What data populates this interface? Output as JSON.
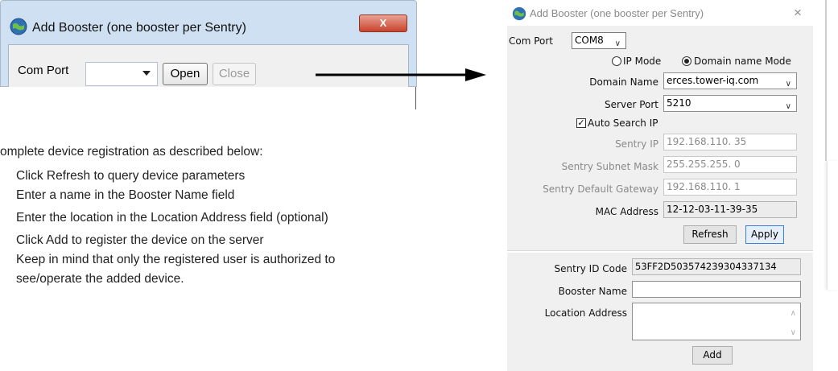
{
  "small_dialog": {
    "title": "Add Booster (one booster per Sentry)",
    "close_glyph": "X",
    "com_port_label": "Com Port",
    "com_port_value": "",
    "open_label": "Open",
    "close_label": "Close"
  },
  "instructions": {
    "intro": "omplete device registration as described below:",
    "steps": [
      "Click Refresh to query device parameters",
      "Enter a name in the Booster Name field",
      "Enter the location in the Location Address field (optional)",
      "Click Add to register the device on the server",
      "Keep in mind that only the registered user is authorized to",
      "see/operate the added device."
    ]
  },
  "dialog": {
    "title": "Add Booster (one booster per Sentry)",
    "close_glyph": "×",
    "com_port_label": "Com Port",
    "com_port_value": "COM8",
    "ip_mode_label": "IP Mode",
    "domain_mode_label": "Domain name Mode",
    "selected_mode": "domain",
    "domain_name_label": "Domain Name",
    "domain_name_value": "erces.tower-iq.com",
    "server_port_label": "Server Port",
    "server_port_value": "5210",
    "auto_search_label": "Auto Search IP",
    "auto_search_checked": true,
    "sentry_ip_label": "Sentry IP",
    "sentry_ip_value": "192.168.110. 35",
    "subnet_mask_label": "Sentry Subnet Mask",
    "subnet_mask_value": "255.255.255. 0",
    "gateway_label": "Sentry Default Gateway",
    "gateway_value": "192.168.110. 1",
    "mac_label": "MAC Address",
    "mac_value": "12-12-03-11-39-35",
    "refresh_label": "Refresh",
    "apply_label": "Apply",
    "sentry_id_label": "Sentry ID Code",
    "sentry_id_value": "53FF2D503574239304337134",
    "booster_name_label": "Booster Name",
    "booster_name_value": "",
    "location_label": "Location Address",
    "location_value": "",
    "add_label": "Add"
  }
}
